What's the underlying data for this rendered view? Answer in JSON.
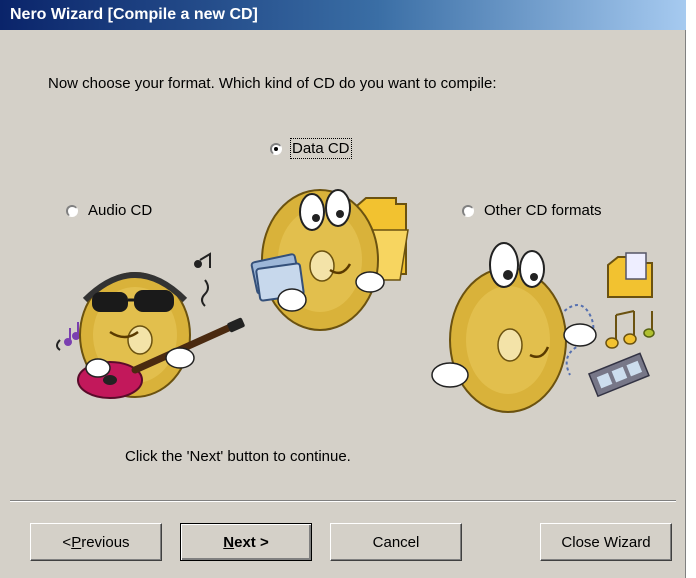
{
  "window": {
    "title": "Nero Wizard [Compile a new CD]"
  },
  "prompt": "Now choose your format. Which kind of CD do you want to compile:",
  "options": [
    {
      "label": "Data CD",
      "checked": true
    },
    {
      "label": "Audio CD",
      "checked": false
    },
    {
      "label": "Other CD formats",
      "checked": false
    }
  ],
  "instructions": "Click the 'Next' button to continue.",
  "buttons": {
    "previous": {
      "mnemonic": "P",
      "rest": "revious",
      "prefix": "< "
    },
    "next": {
      "mnemonic": "N",
      "rest": "ext >"
    },
    "cancel": "Cancel",
    "close": "Close Wizard"
  },
  "colors": {
    "face": "#d4d0c8",
    "title_start": "#0a246a",
    "title_end": "#a6caf0",
    "disc_gold": "#d9b23a"
  }
}
